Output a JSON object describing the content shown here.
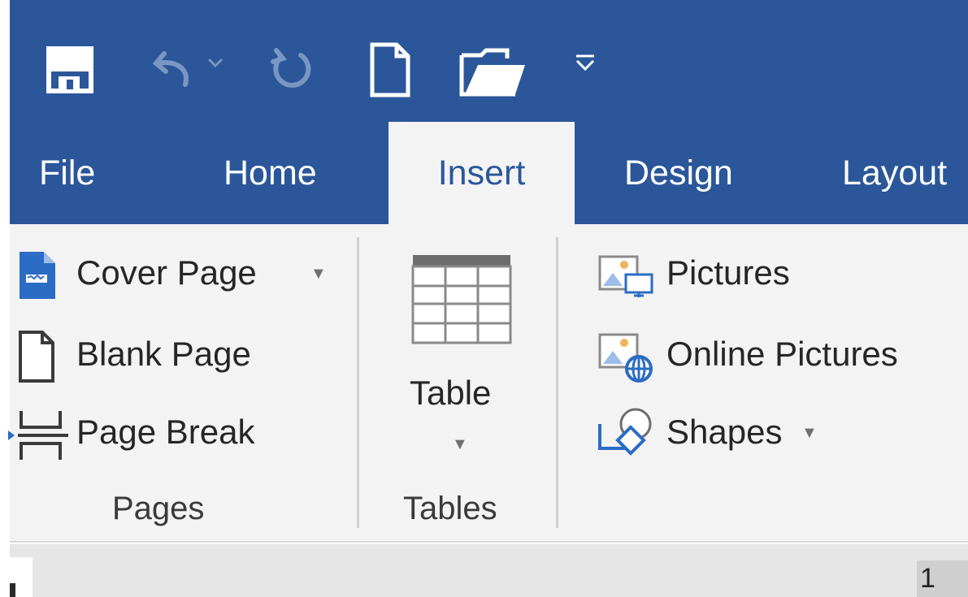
{
  "quick_access_toolbar": {
    "icons": [
      "save-icon",
      "undo-icon",
      "undo-dropdown-icon",
      "redo-icon",
      "new-document-icon",
      "open-folder-icon",
      "customize-toolbar-icon"
    ]
  },
  "tabs": [
    {
      "label": "File"
    },
    {
      "label": "Home"
    },
    {
      "label": "Insert",
      "active": true
    },
    {
      "label": "Design"
    },
    {
      "label": "Layout"
    }
  ],
  "ribbon": {
    "pages": {
      "label": "Pages",
      "items": [
        {
          "label": "Cover Page",
          "dropdown": true
        },
        {
          "label": "Blank Page"
        },
        {
          "label": "Page Break"
        }
      ]
    },
    "tables": {
      "label": "Tables",
      "items": [
        {
          "label": "Table",
          "dropdown": true
        }
      ]
    },
    "illustrations": {
      "items": [
        {
          "label": "Pictures"
        },
        {
          "label": "Online Pictures"
        },
        {
          "label": "Shapes",
          "dropdown": true
        }
      ]
    }
  },
  "status": {
    "page_number": "1"
  },
  "colors": {
    "brand": "#2b579a",
    "ribbon_bg": "#f3f3f3",
    "accent_icon": "#2b6cc4",
    "picture_accent": "#f0b35a"
  }
}
